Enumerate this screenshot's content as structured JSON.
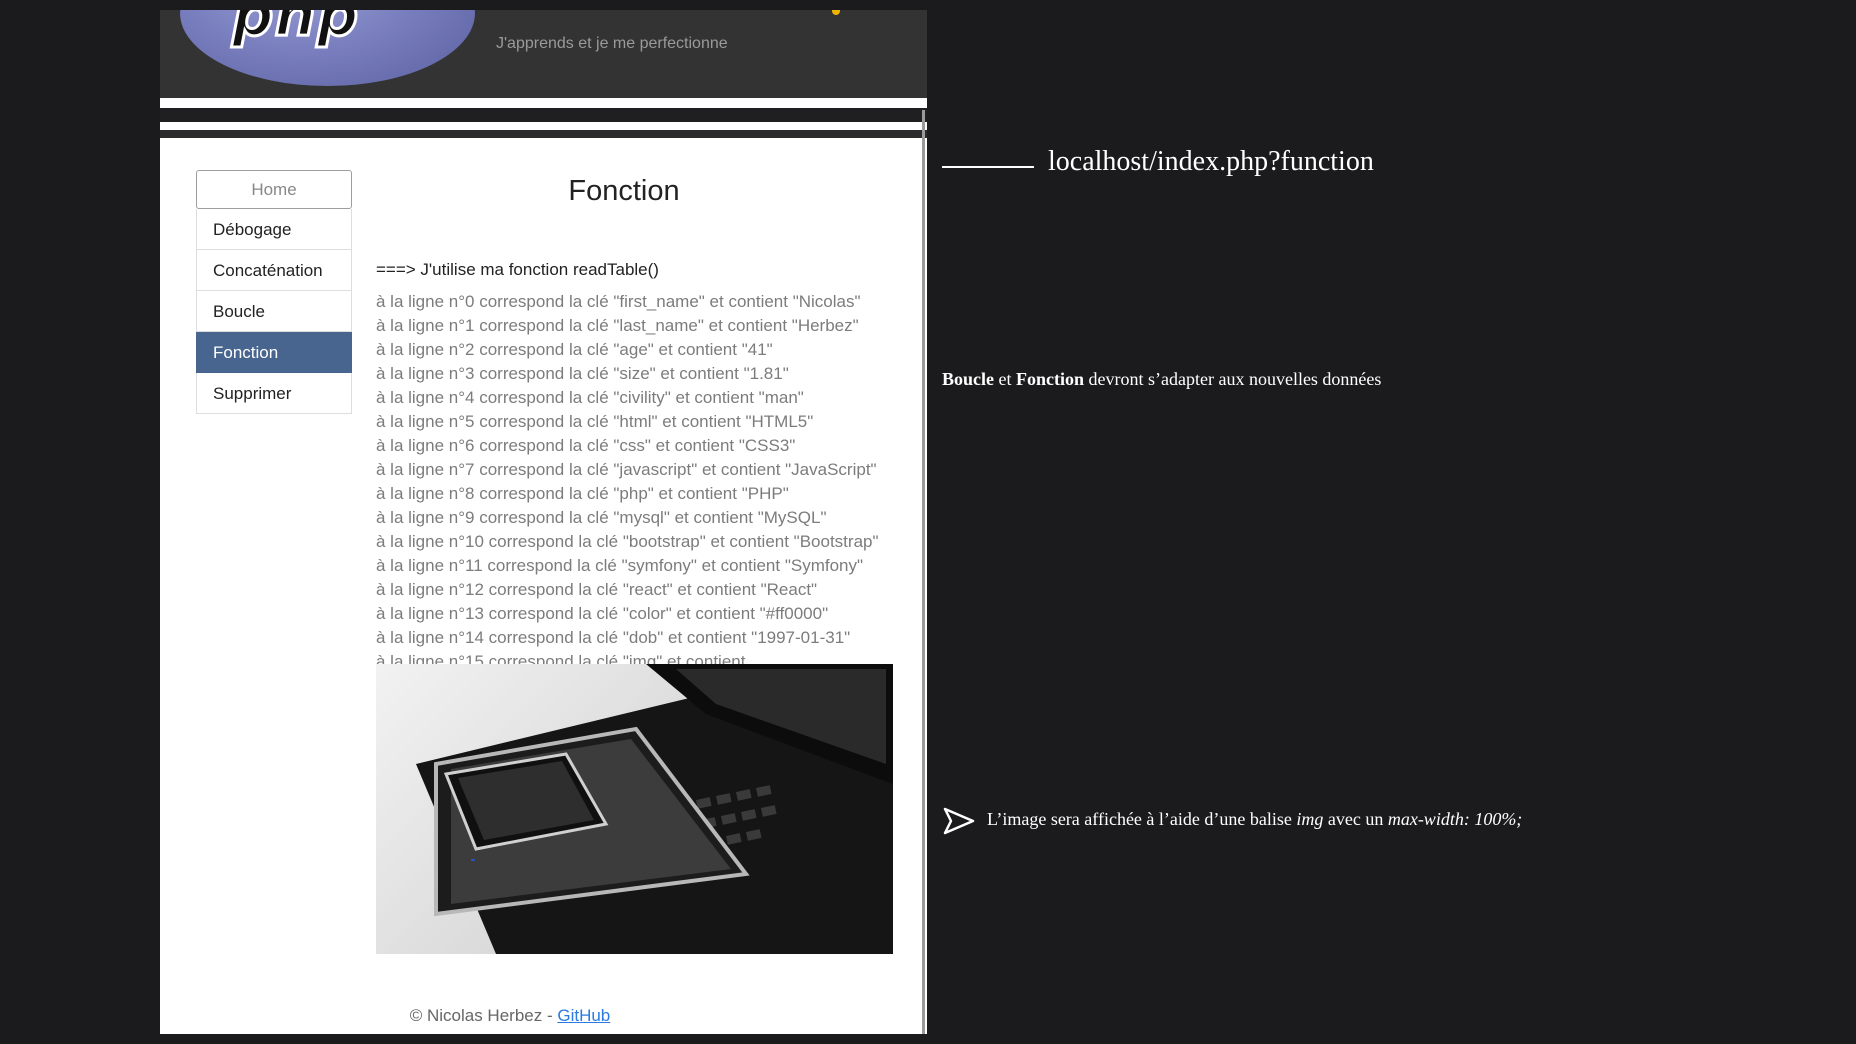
{
  "header": {
    "logo_text": "php",
    "tagline": "J'apprends et je me perfectionne"
  },
  "nav": {
    "items": [
      {
        "label": "Home",
        "state": "home"
      },
      {
        "label": "Débogage",
        "state": "normal"
      },
      {
        "label": "Concaténation",
        "state": "normal"
      },
      {
        "label": "Boucle",
        "state": "normal"
      },
      {
        "label": "Fonction",
        "state": "active"
      },
      {
        "label": "Supprimer",
        "state": "normal"
      }
    ]
  },
  "main": {
    "title": "Fonction",
    "intro": "===> J'utilise ma fonction readTable()",
    "rows": [
      "à la ligne n°0 correspond la clé \"first_name\" et contient \"Nicolas\"",
      "à la ligne n°1 correspond la clé \"last_name\" et contient \"Herbez\"",
      "à la ligne n°2 correspond la clé \"age\" et contient \"41\"",
      "à la ligne n°3 correspond la clé \"size\" et contient \"1.81\"",
      "à la ligne n°4 correspond la clé \"civility\" et contient \"man\"",
      "à la ligne n°5 correspond la clé \"html\" et contient \"HTML5\"",
      "à la ligne n°6 correspond la clé \"css\" et contient \"CSS3\"",
      "à la ligne n°7 correspond la clé \"javascript\" et contient \"JavaScript\"",
      "à la ligne n°8 correspond la clé \"php\" et contient \"PHP\"",
      "à la ligne n°9 correspond la clé \"mysql\" et contient \"MySQL\"",
      "à la ligne n°10 correspond la clé \"bootstrap\" et contient \"Bootstrap\"",
      "à la ligne n°11 correspond la clé \"symfony\" et contient \"Symfony\"",
      "à la ligne n°12 correspond la clé \"react\" et contient \"React\"",
      "à la ligne n°13 correspond la clé \"color\" et contient \"#ff0000\"",
      "à la ligne n°14 correspond la clé \"dob\" et contient \"1997-01-31\"",
      "à la ligne n°15 correspond la clé \"img\" et contient"
    ],
    "image_icon": "devices-photo"
  },
  "footer": {
    "text": "© Nicolas Herbez - ",
    "link_label": "GitHub"
  },
  "annotations": {
    "url": "localhost/index.php?function",
    "boucle_word": "Boucle",
    "and_word": " et ",
    "fonction_word": "Fonction",
    "boucle_rest": " devront s’adapter aux nouvelles données",
    "img_prefix": "L’image sera affichée à l’aide d’une balise ",
    "img_tag": "img",
    "img_middle": " avec un ",
    "img_style": "max-width: 100%;"
  },
  "colors": {
    "page_background": "#1b1b1d",
    "header_background": "#333333",
    "nav_active": "#48658f",
    "link": "#2a7ae2"
  }
}
